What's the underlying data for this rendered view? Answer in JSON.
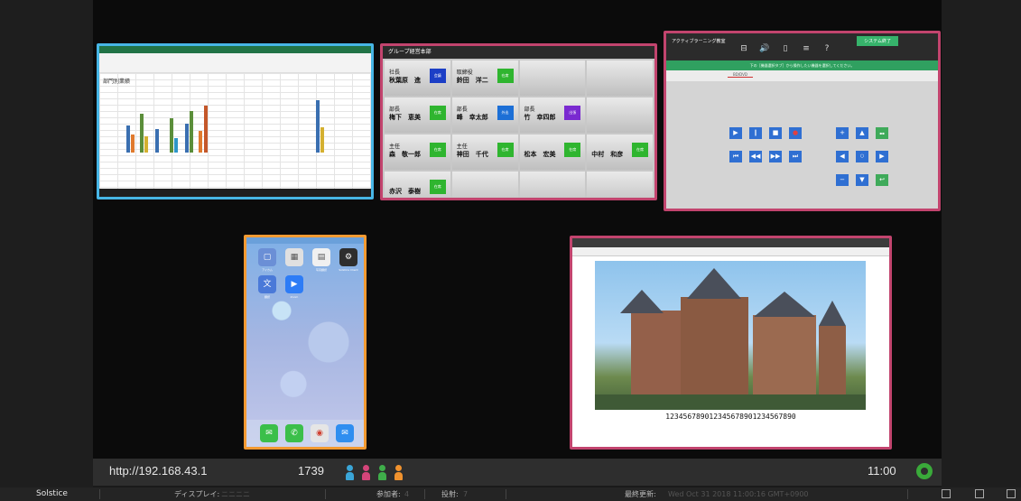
{
  "status_bar": {
    "url": "http://192.168.43.1",
    "count": "1739",
    "time": "11:00",
    "user_colors": [
      "#3aa6d8",
      "#d4457a",
      "#3fae4a",
      "#f0922e"
    ]
  },
  "info_bar": {
    "brand": "Solstice",
    "display_label": "ディスプレイ:",
    "display_value": "ニニニニ",
    "participants_label": "参加者:",
    "participants_value": "4",
    "posts_label": "投射:",
    "posts_value": "7",
    "updated_label": "最終更新:",
    "updated_value": "Wed Oct 31 2018 11:00:16 GMT+0900"
  },
  "excel_post": {
    "chart_title": "部門別業績",
    "border_color": "#47b6e6"
  },
  "org_post": {
    "title": "グループ経営本部",
    "cells": [
      {
        "role": "社長",
        "name": "秋葉原　進",
        "status": "会議",
        "color": "#1c3fc6"
      },
      {
        "role": "取締役",
        "name": "鈴田　洋二",
        "status": "在席",
        "color": "#2fb52f"
      },
      {
        "role": "",
        "name": "",
        "status": "",
        "color": ""
      },
      {
        "role": "",
        "name": "",
        "status": "",
        "color": ""
      },
      {
        "role": "部長",
        "name": "梅下　恵美",
        "status": "在席",
        "color": "#2fb52f"
      },
      {
        "role": "部長",
        "name": "峰　幸太郎",
        "status": "外出",
        "color": "#1c6fd6"
      },
      {
        "role": "部長",
        "name": "竹　幸四郎",
        "status": "出張",
        "color": "#7a2ad0"
      },
      {
        "role": "",
        "name": "",
        "status": "",
        "color": ""
      },
      {
        "role": "主任",
        "name": "森　敬一郎",
        "status": "在席",
        "color": "#2fb52f"
      },
      {
        "role": "主任",
        "name": "神田　千代",
        "status": "在席",
        "color": "#2fb52f"
      },
      {
        "role": "",
        "name": "松本　宏美",
        "status": "在席",
        "color": "#2fb52f"
      },
      {
        "role": "",
        "name": "中村　和彦",
        "status": "在席",
        "color": "#2fb52f"
      },
      {
        "role": "",
        "name": "赤沢　泰樹",
        "status": "在席",
        "color": "#2fb52f"
      },
      {
        "role": "",
        "name": "",
        "status": "",
        "color": ""
      },
      {
        "role": "",
        "name": "",
        "status": "",
        "color": ""
      },
      {
        "role": "",
        "name": "",
        "status": "",
        "color": ""
      }
    ]
  },
  "control_post": {
    "title": "アクティブラーニング教室",
    "end_button": "システム終了",
    "icons": [
      {
        "glyph": "⊟",
        "name": "display-icon"
      },
      {
        "glyph": "🔊",
        "name": "volume-icon"
      },
      {
        "glyph": "▯",
        "name": "remote-icon"
      },
      {
        "glyph": "≡",
        "name": "mixer-icon"
      },
      {
        "glyph": "?",
        "name": "help-icon"
      }
    ],
    "banner": "下の［機器選択タブ］から操作したい機器を選択してください。",
    "tab": "BD/DVD"
  },
  "phone_post": {
    "apps": [
      {
        "label": "アイカム",
        "color": "#6b8fd6",
        "glyph": "▢"
      },
      {
        "label": "",
        "color": "#e0e0e0",
        "glyph": "▦"
      },
      {
        "label": "写真翻訳",
        "color": "#f0f0f0",
        "glyph": "▤"
      },
      {
        "label": "Solstice Client",
        "color": "#2e2e2e",
        "glyph": "⚙"
      },
      {
        "label": "翻訳",
        "color": "#4a79d8",
        "glyph": "文"
      },
      {
        "label": "Zoom",
        "color": "#2d7cf6",
        "glyph": "▶"
      }
    ],
    "dock": [
      {
        "color": "#3bbf4a",
        "glyph": "✉",
        "name": "messages-app-icon"
      },
      {
        "color": "#3bbf4a",
        "glyph": "✆",
        "name": "phone-app-icon"
      },
      {
        "color": "#e5e5e5",
        "glyph": "◉",
        "name": "chrome-app-icon"
      },
      {
        "color": "#2f8ef0",
        "glyph": "✉",
        "name": "mail-app-icon"
      }
    ]
  },
  "castle_post": {
    "caption": "123456789012345678901234567890"
  }
}
